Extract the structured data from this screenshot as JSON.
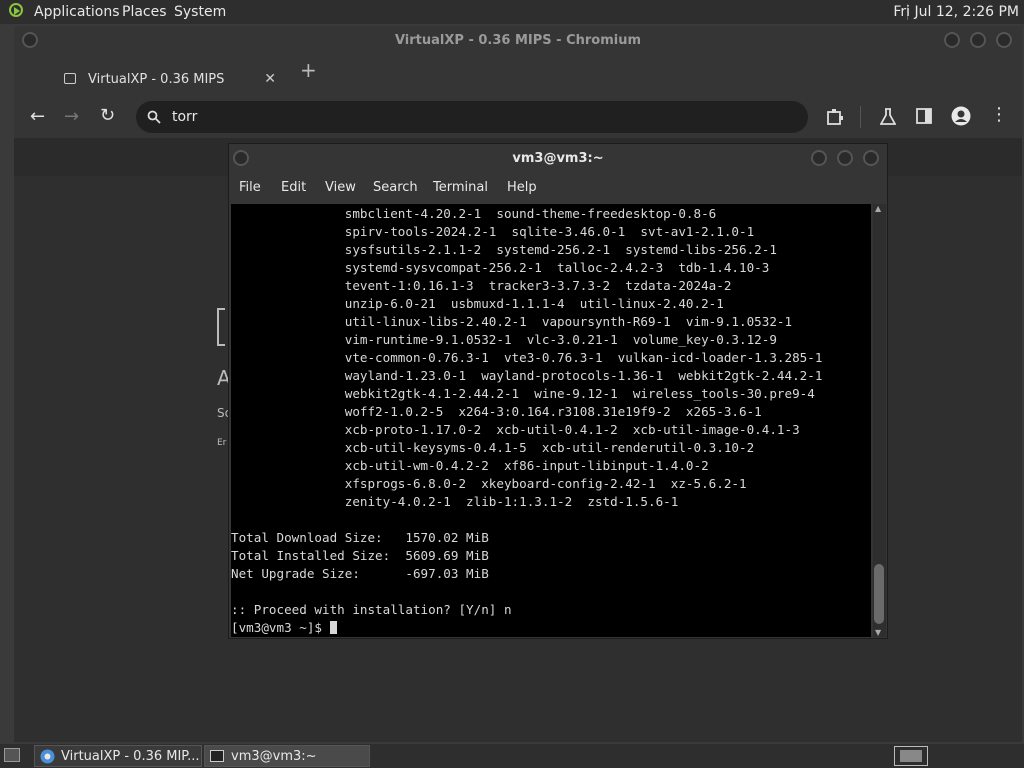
{
  "top_panel": {
    "menus": [
      "Applications",
      "Places",
      "System"
    ],
    "clock": "Fri Jul 12,  2:26 PM"
  },
  "chromium": {
    "window_title": "VirtualXP - 0.36 MIPS - Chromium",
    "tab_title": "VirtualXP - 0.36 MIPS",
    "omnibox_text": "torr",
    "page_fragments": [
      "A",
      "Sc",
      "Er"
    ]
  },
  "terminal": {
    "title": "vm3@vm3:~",
    "menus": [
      "File",
      "Edit",
      "View",
      "Search",
      "Terminal",
      "Help"
    ],
    "lines": [
      "               smbclient-4.20.2-1  sound-theme-freedesktop-0.8-6",
      "               spirv-tools-2024.2-1  sqlite-3.46.0-1  svt-av1-2.1.0-1",
      "               sysfsutils-2.1.1-2  systemd-256.2-1  systemd-libs-256.2-1",
      "               systemd-sysvcompat-256.2-1  talloc-2.4.2-3  tdb-1.4.10-3",
      "               tevent-1:0.16.1-3  tracker3-3.7.3-2  tzdata-2024a-2",
      "               unzip-6.0-21  usbmuxd-1.1.1-4  util-linux-2.40.2-1",
      "               util-linux-libs-2.40.2-1  vapoursynth-R69-1  vim-9.1.0532-1",
      "               vim-runtime-9.1.0532-1  vlc-3.0.21-1  volume_key-0.3.12-9",
      "               vte-common-0.76.3-1  vte3-0.76.3-1  vulkan-icd-loader-1.3.285-1",
      "               wayland-1.23.0-1  wayland-protocols-1.36-1  webkit2gtk-2.44.2-1",
      "               webkit2gtk-4.1-2.44.2-1  wine-9.12-1  wireless_tools-30.pre9-4",
      "               woff2-1.0.2-5  x264-3:0.164.r3108.31e19f9-2  x265-3.6-1",
      "               xcb-proto-1.17.0-2  xcb-util-0.4.1-2  xcb-util-image-0.4.1-3",
      "               xcb-util-keysyms-0.4.1-5  xcb-util-renderutil-0.3.10-2",
      "               xcb-util-wm-0.4.2-2  xf86-input-libinput-1.4.0-2",
      "               xfsprogs-6.8.0-2  xkeyboard-config-2.42-1  xz-5.6.2-1",
      "               zenity-4.0.2-1  zlib-1:1.3.1-2  zstd-1.5.6-1",
      "",
      "Total Download Size:   1570.02 MiB",
      "Total Installed Size:  5609.69 MiB",
      "Net Upgrade Size:      -697.03 MiB",
      "",
      ":: Proceed with installation? [Y/n] n",
      "[vm3@vm3 ~]$ "
    ]
  },
  "taskbar": {
    "tasks": [
      "VirtualXP - 0.36 MIP...",
      "vm3@vm3:~"
    ]
  },
  "colors": {
    "panel": "#2e2e2e",
    "terminal_bg": "#000000",
    "terminal_fg": "#d8d8d8"
  }
}
